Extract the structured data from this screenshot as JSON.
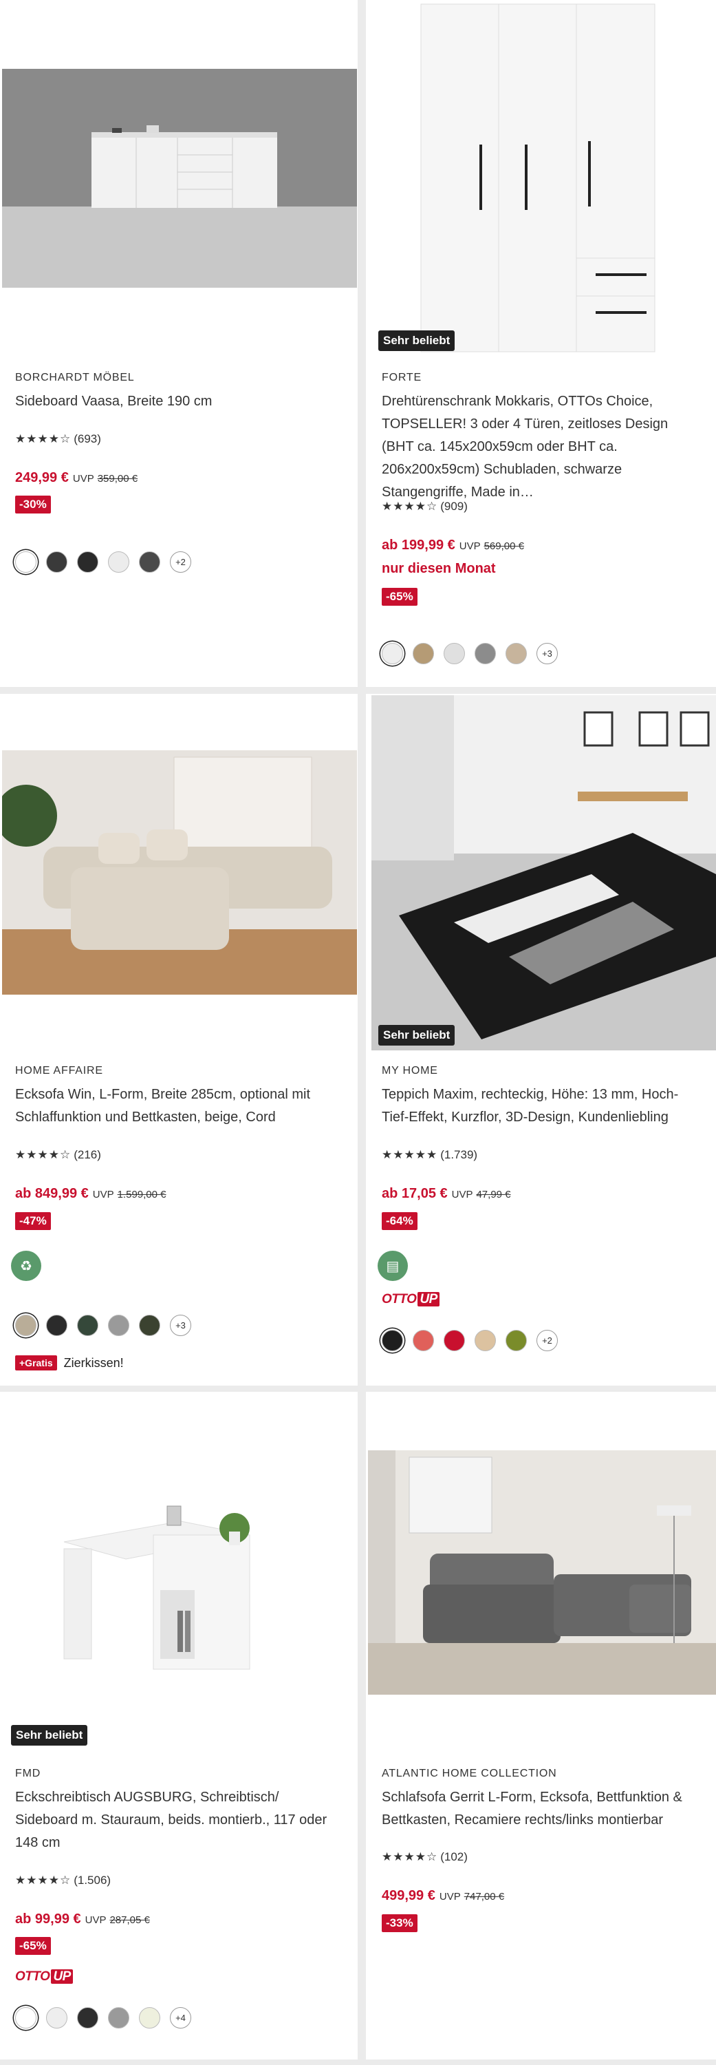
{
  "products": [
    {
      "brand": "BORCHARDT MÖBEL",
      "title": "Sideboard Vaasa, Breite 190 cm",
      "stars": "★★★★☆",
      "reviews": "(693)",
      "price": "249,99 €",
      "uvp_label": "UVP",
      "old_price": "359,00 €",
      "discount": "-30%",
      "swatches": [
        "#ffffff",
        "#3a3a3a",
        "#2a2a2a",
        "#ececec",
        "#4a4a4a"
      ],
      "more": "+2"
    },
    {
      "badge": "Sehr beliebt",
      "brand": "FORTE",
      "title": "Drehtürenschrank Mokkaris, OTTOs Choice, TOPSELLER! 3 oder 4 Türen, zeitloses Design (BHT ca. 145x200x59cm oder BHT ca. 206x200x59cm) Schubladen, schwarze Stangengriffe, Made in…",
      "stars": "★★★★☆",
      "reviews": "(909)",
      "price": "ab 199,99 €",
      "uvp_label": "UVP",
      "old_price": "569,00 €",
      "promo": "nur diesen Monat",
      "discount": "-65%",
      "swatches": [
        "#eeeeee",
        "#b59b75",
        "#e0e0e0",
        "#8c8c8c",
        "#c7b49c"
      ],
      "more": "+3"
    },
    {
      "brand": "HOME AFFAIRE",
      "title": "Ecksofa Win, L-Form, Breite 285cm, optional mit Schlaffunktion und Bettkasten, beige, Cord",
      "stars": "★★★★☆",
      "reviews": "(216)",
      "price": "ab 849,99 €",
      "uvp_label": "UVP",
      "old_price": "1.599,00 €",
      "discount": "-47%",
      "eco_icon": "sustainability-icon",
      "swatches": [
        "#b9ad98",
        "#2b2b2b",
        "#35483a",
        "#9a9a9a",
        "#3b4230"
      ],
      "more": "+3",
      "gratis_label": "+Gratis",
      "gratis_text": "Zierkissen!"
    },
    {
      "badge": "Sehr beliebt",
      "brand": "MY HOME",
      "title": "Teppich Maxim, rechteckig, Höhe: 13 mm, Hoch-Tief-Effekt, Kurzflor, 3D-Design, Kundenliebling",
      "stars": "★★★★★",
      "reviews": "(1.739)",
      "price": "ab 17,05 €",
      "uvp_label": "UVP",
      "old_price": "47,99 €",
      "discount": "-64%",
      "eco_icon": "certificate-icon",
      "ottoup": "OTTO",
      "ottoup_up": "UP",
      "swatches": [
        "#1e1e1e",
        "#e0605a",
        "#c8102e",
        "#dcc2a0",
        "#7a8c2a"
      ],
      "more": "+2"
    },
    {
      "badge": "Sehr beliebt",
      "brand": "FMD",
      "title": "Eckschreibtisch AUGSBURG, Schreibtisch/ Sideboard m. Stauraum, beids. montierb., 117 oder 148 cm",
      "stars": "★★★★☆",
      "reviews": "(1.506)",
      "price": "ab 99,99 €",
      "uvp_label": "UVP",
      "old_price": "287,05 €",
      "discount": "-65%",
      "ottoup": "OTTO",
      "ottoup_up": "UP",
      "swatches": [
        "#ffffff",
        "#eeeeee",
        "#2e2e2e",
        "#9a9a9a",
        "#eef0de"
      ],
      "more": "+4"
    },
    {
      "brand": "ATLANTIC HOME COLLECTION",
      "title": "Schlafsofa Gerrit L-Form, Ecksofa, Bettfunktion & Bettkasten, Recamiere rechts/links montierbar",
      "stars": "★★★★☆",
      "reviews": "(102)",
      "price": "499,99 €",
      "uvp_label": "UVP",
      "old_price": "747,00 €",
      "discount": "-33%"
    }
  ]
}
